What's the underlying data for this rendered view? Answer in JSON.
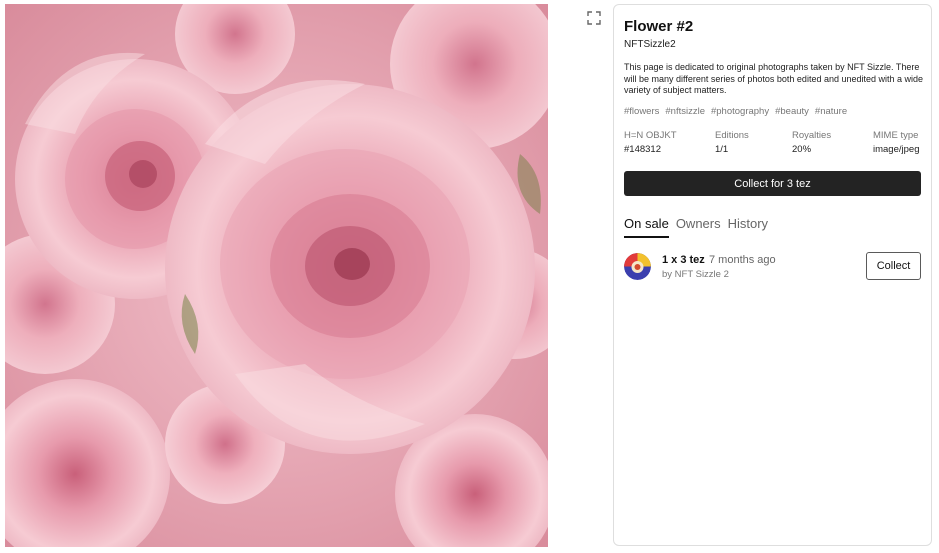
{
  "artwork": {
    "description_icon": "roses-photo"
  },
  "expand": {
    "icon": "expand-icon"
  },
  "token": {
    "title": "Flower #2",
    "creator": "NFTSizzle2",
    "description": "This page is dedicated to original photographs taken by NFT Sizzle. There will be many different series of photos both edited and unedited with a wide variety of subject matters.",
    "tags": [
      "#flowers",
      "#nftsizzle",
      "#photography",
      "#beauty",
      "#nature"
    ]
  },
  "meta": {
    "objkt": {
      "label": "H=N OBJKT",
      "value": "#148312"
    },
    "editions": {
      "label": "Editions",
      "value": "1/1"
    },
    "royalties": {
      "label": "Royalties",
      "value": "20%"
    },
    "mime": {
      "label": "MIME type",
      "value": "image/jpeg"
    }
  },
  "collect_main": "Collect for 3 tez",
  "tabs": [
    "On sale",
    "Owners",
    "History"
  ],
  "listing": {
    "price": "1 x 3 tez",
    "time": "7 months ago",
    "by": "by NFT Sizzle 2",
    "button": "Collect"
  },
  "colors": {
    "button_dark": "#232323",
    "muted": "#777777",
    "artwork_pink": "#e9a7b5"
  }
}
